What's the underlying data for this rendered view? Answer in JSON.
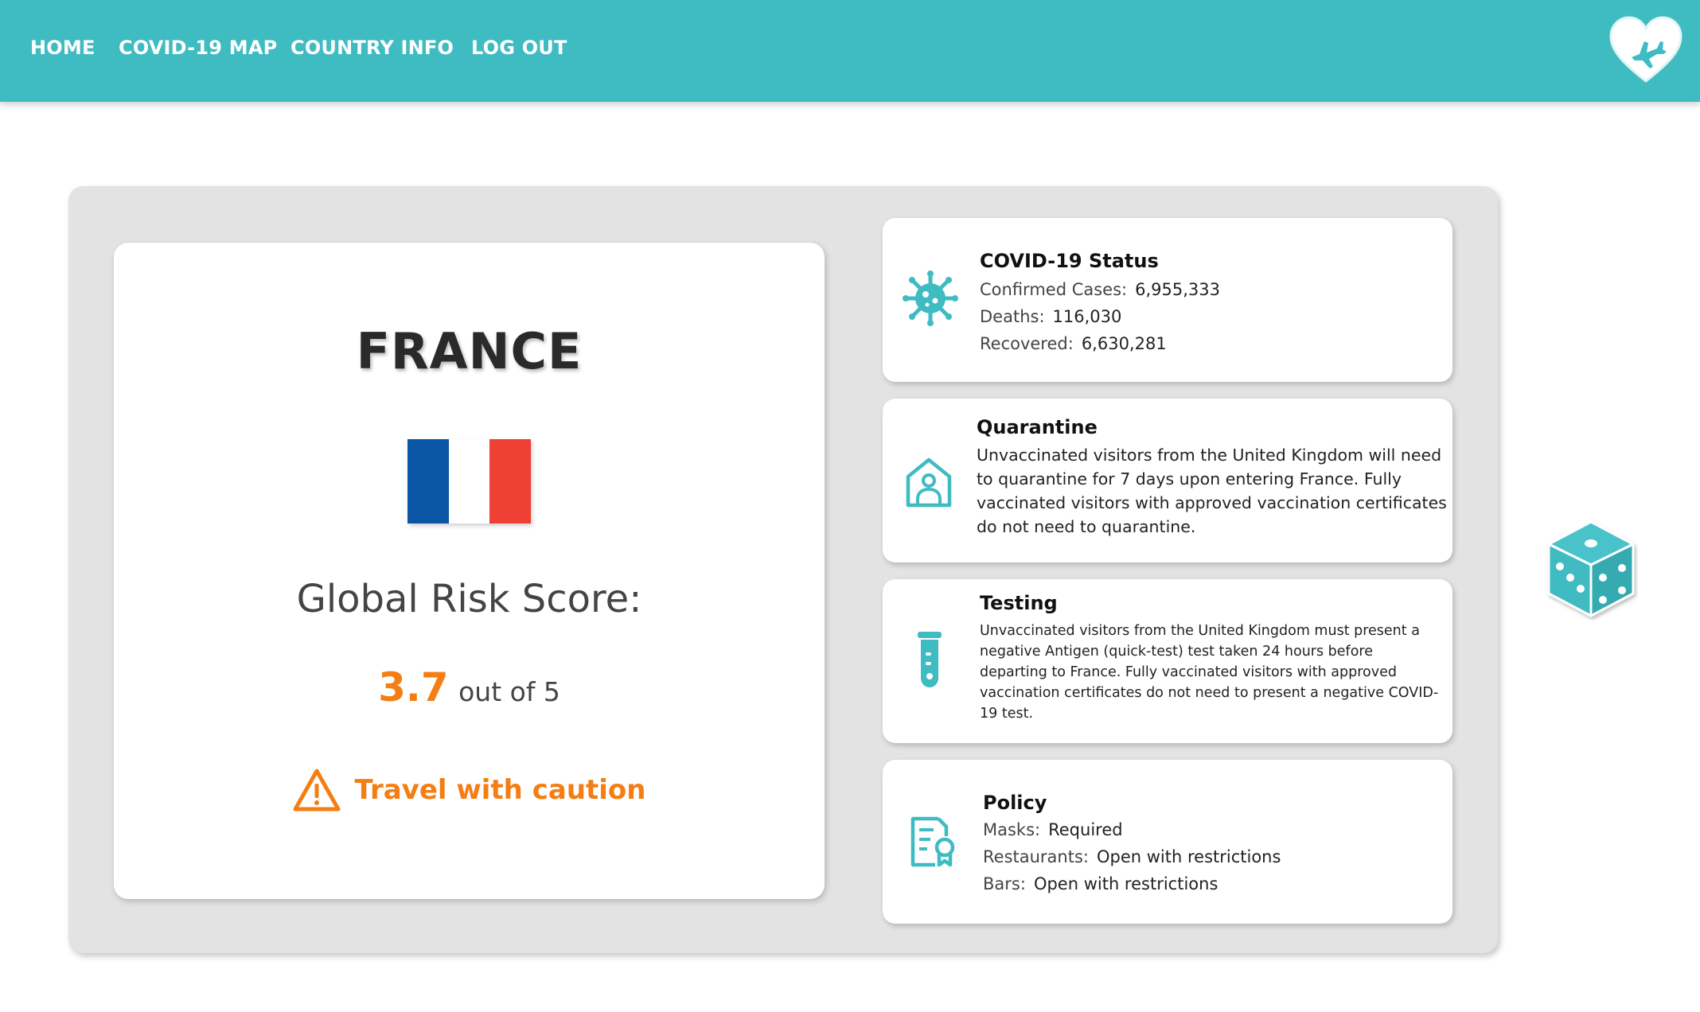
{
  "nav": {
    "links": [
      "HOME",
      "COVID-19 MAP",
      "COUNTRY INFO",
      "LOG OUT"
    ],
    "logo_icon": "heart-plane-icon",
    "color": "#3fbbc2"
  },
  "country": {
    "name": "FRANCE",
    "flag_colors": [
      "#0b55a5",
      "#ffffff",
      "#ee4035"
    ],
    "risk_label": "Global Risk Score:",
    "score": "3.7",
    "score_suffix": "out of 5",
    "advice": "Travel with caution",
    "advice_icon": "warning-icon",
    "accent": "#f47e13"
  },
  "covid_status": {
    "icon": "virus-icon",
    "title": "COVID-19 Status",
    "rows": [
      {
        "key": "Confirmed Cases:",
        "value": "6,955,333"
      },
      {
        "key": "Deaths:",
        "value": "116,030"
      },
      {
        "key": "Recovered:",
        "value": "6,630,281"
      }
    ]
  },
  "quarantine": {
    "icon": "house-person-icon",
    "title": "Quarantine",
    "lines": [
      "Unvaccinated visitors from the United Kingdom will need",
      "to quarantine for 7 days upon entering France. Fully",
      "vaccinated visitors with approved vaccination certificates",
      "do not need to quarantine."
    ]
  },
  "testing": {
    "icon": "test-tube-icon",
    "title": "Testing",
    "lines": [
      "Unvaccinated visitors from the United Kingdom must present a",
      "negative Antigen (quick-test) test taken 24 hours before",
      "departing to France. Fully vaccinated visitors with approved",
      "vaccination certificates do not need to present a negative COVID-",
      "19 test."
    ]
  },
  "policy": {
    "icon": "certificate-icon",
    "title": "Policy",
    "rows": [
      {
        "key": "Masks:",
        "value": "Required"
      },
      {
        "key": "Restaurants:",
        "value": "Open with restrictions"
      },
      {
        "key": "Bars:",
        "value": "Open with restrictions"
      }
    ]
  },
  "random_button": {
    "icon": "dice-icon"
  },
  "theme": {
    "teal": "#3fbbc2",
    "panel": "#e3e3e3"
  }
}
